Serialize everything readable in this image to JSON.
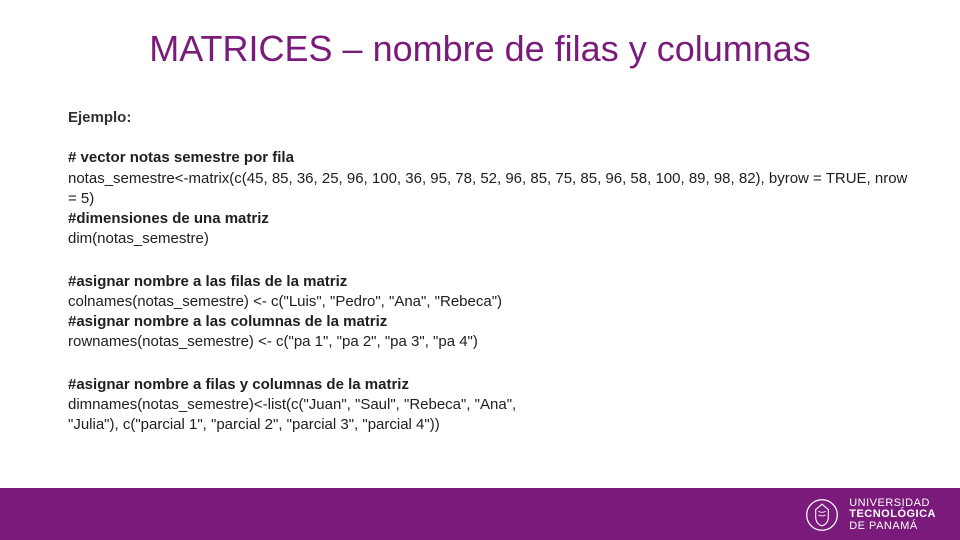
{
  "title": "MATRICES – nombre de filas y columnas",
  "example_label": "Ejemplo:",
  "block1": {
    "c1": "# vector notas semestre por fila",
    "l1": "notas_semestre<-matrix(c(45, 85, 36, 25, 96, 100, 36, 95, 78, 52, 96, 85, 75, 85, 96, 58,  100, 89, 98, 82), byrow = TRUE, nrow = 5)",
    "c2": "#dimensiones de una matriz",
    "l2": "dim(notas_semestre)"
  },
  "block2": {
    "c1": "#asignar nombre a las filas de la matriz",
    "l1": "colnames(notas_semestre) <- c(\"Luis\", \"Pedro\", \"Ana\", \"Rebeca\")",
    "c2": "#asignar nombre a las columnas de la matriz",
    "l2": "rownames(notas_semestre) <- c(\"pa 1\", \"pa 2\", \"pa 3\", \"pa 4\")"
  },
  "block3": {
    "c1": "#asignar nombre a filas y columnas de la matriz",
    "l1": "dimnames(notas_semestre)<-list(c(\"Juan\", \"Saul\", \"Rebeca\", \"Ana\",",
    "l2": " \"Julia\"), c(\"parcial 1\", \"parcial 2\", \"parcial 3\", \"parcial 4\"))"
  },
  "footer": {
    "l1": "UNIVERSIDAD",
    "l2": "TECNOLÓGICA",
    "l3": "DE PANAMÁ"
  }
}
